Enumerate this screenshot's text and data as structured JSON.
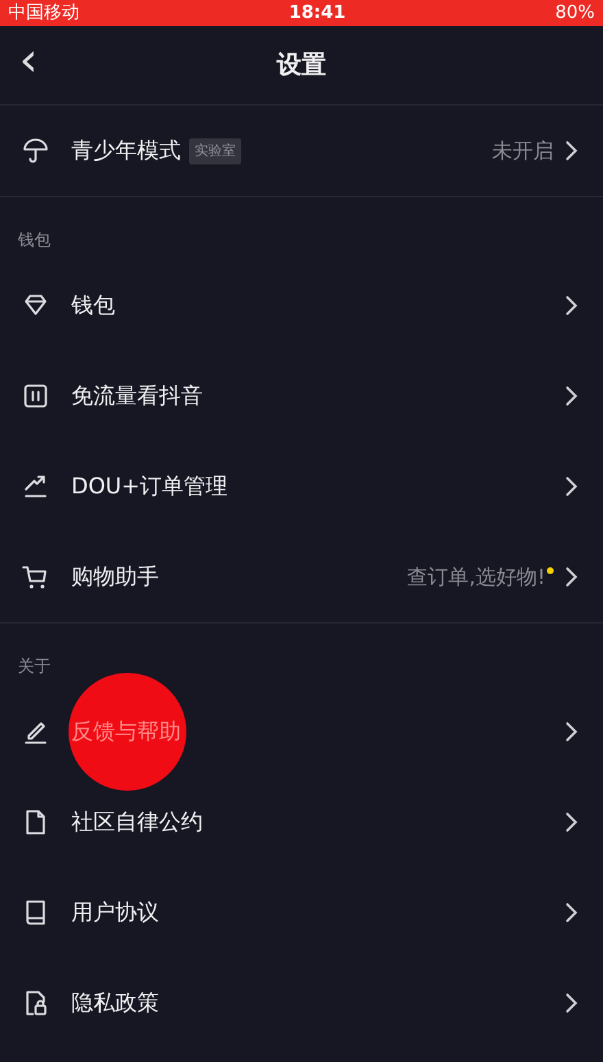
{
  "status_bar": {
    "carrier": "中国移动",
    "time": "18:41",
    "battery": "80%"
  },
  "header": {
    "back": "‹",
    "title": "设置"
  },
  "sections": [
    {
      "items": [
        {
          "label": "青少年模式",
          "badge": "实验室",
          "value": "未开启"
        }
      ]
    },
    {
      "heading": "钱包",
      "items": [
        {
          "label": "钱包"
        },
        {
          "label": "免流量看抖音"
        },
        {
          "label": "DOU+订单管理"
        },
        {
          "label": "购物助手",
          "value": "查订单,选好物!",
          "new_dot": true
        }
      ]
    },
    {
      "heading": "关于",
      "items": [
        {
          "label": "反馈与帮助",
          "touched": true
        },
        {
          "label": "社区自律公约"
        },
        {
          "label": "用户协议"
        },
        {
          "label": "隐私政策"
        }
      ]
    }
  ]
}
